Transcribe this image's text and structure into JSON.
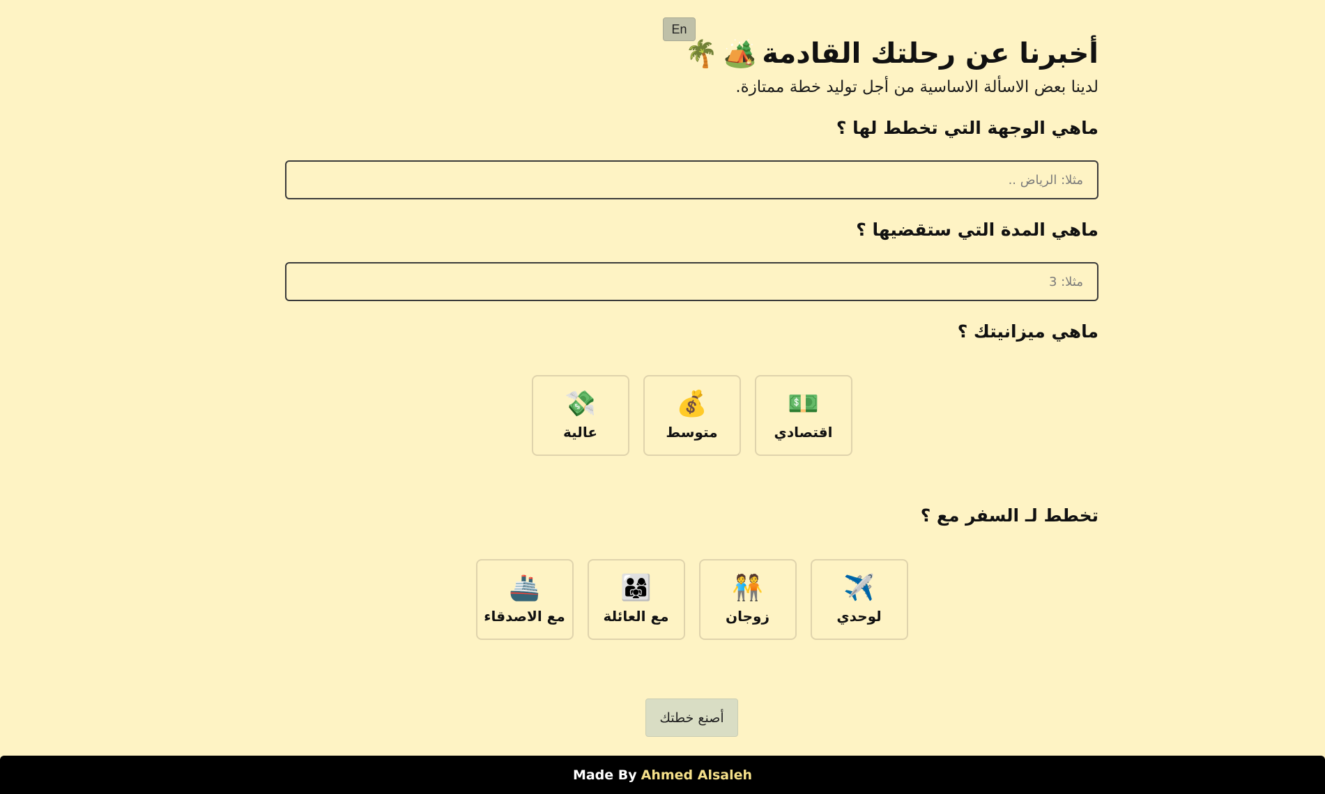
{
  "language_toggle": {
    "label": "En"
  },
  "header": {
    "title": "أخبرنا عن رحلتك القادمة",
    "title_emojis": [
      "🏕️",
      "🌴"
    ],
    "subtitle": "لدينا بعض الاسألة الاساسية من أجل توليد خطة ممتازة."
  },
  "destination": {
    "question": "ماهي الوجهة التي تخطط لها ؟",
    "placeholder": "مثلا: الرياض ..",
    "value": ""
  },
  "duration": {
    "question": "ماهي المدة التي ستقضيها ؟",
    "placeholder": "مثلا: 3",
    "value": ""
  },
  "budget": {
    "question": "ماهي ميزانيتك ؟",
    "options": [
      {
        "label": "اقتصادي",
        "icon": "💵",
        "icon_name": "dollar-banknote-icon"
      },
      {
        "label": "متوسط",
        "icon": "💰",
        "icon_name": "money-bag-icon"
      },
      {
        "label": "عالية",
        "icon": "💸",
        "icon_name": "money-with-wings-icon"
      }
    ]
  },
  "travel_with": {
    "question": "تخطط لـ السفر مع ؟",
    "options": [
      {
        "label": "لوحدي",
        "icon": "✈️",
        "icon_name": "airplane-icon"
      },
      {
        "label": "زوجان",
        "icon": "🧑‍🤝‍🧑",
        "icon_name": "couple-icon"
      },
      {
        "label": "مع العائلة",
        "icon": "👨‍👩‍👧",
        "icon_name": "family-icon"
      },
      {
        "label": "مع الاصدقاء",
        "icon": "🚢",
        "icon_name": "ship-icon"
      }
    ]
  },
  "submit": {
    "label": "أصنع خطتك"
  },
  "footer": {
    "prefix": "Made By",
    "author": "Ahmed Alsaleh"
  }
}
